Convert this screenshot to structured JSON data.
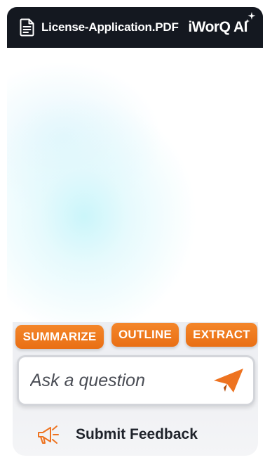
{
  "header": {
    "file_name": "License-Application.PDF",
    "brand": "iWorQ AI",
    "icons": [
      "document-icon",
      "sparkle-icon"
    ]
  },
  "actions": {
    "summarize": "SUMMARIZE",
    "outline": "OUTLINE",
    "extract": "EXTRACT"
  },
  "ask": {
    "placeholder": "Ask a question",
    "send_icon": "paper-plane-icon"
  },
  "feedback": {
    "label": "Submit Feedback",
    "icon": "megaphone-icon"
  },
  "colors": {
    "header_bg": "#141820",
    "accent": "#F07A1E",
    "panel_bg": "#ECEEF2",
    "text_dark": "#1F232B"
  }
}
